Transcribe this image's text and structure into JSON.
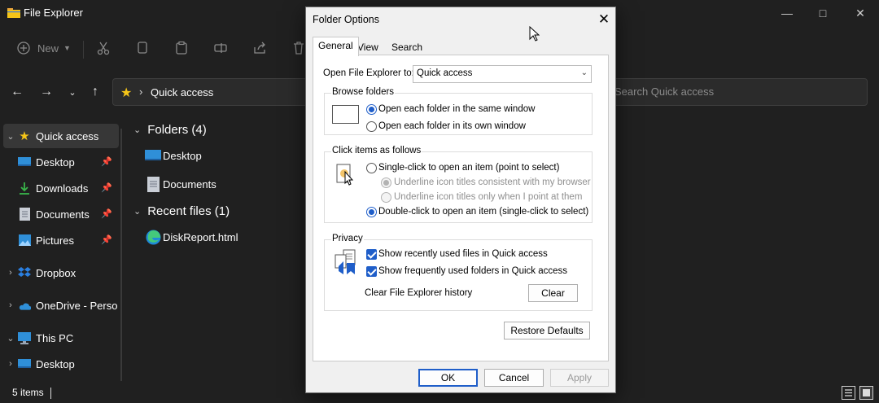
{
  "explorer": {
    "title": "File Explorer",
    "commandbar": {
      "new_label": "New"
    },
    "address": {
      "crumb": "Quick access"
    },
    "search": {
      "placeholder": "Search Quick access"
    },
    "nav_items": [
      {
        "label": "Quick access",
        "icon": "star-icon"
      },
      {
        "label": "Desktop",
        "icon": "desktop-icon"
      },
      {
        "label": "Downloads",
        "icon": "download-icon"
      },
      {
        "label": "Documents",
        "icon": "documents-icon"
      },
      {
        "label": "Pictures",
        "icon": "pictures-icon"
      },
      {
        "label": "Dropbox",
        "icon": "dropbox-icon"
      },
      {
        "label": "OneDrive - Perso",
        "icon": "onedrive-icon"
      },
      {
        "label": "This PC",
        "icon": "pc-icon"
      },
      {
        "label": "Desktop",
        "icon": "desktop-icon"
      }
    ],
    "groups": {
      "folders_header": "Folders (4)",
      "folders": [
        "Desktop",
        "Documents"
      ],
      "recent_header": "Recent files (1)",
      "recent": [
        "DiskReport.html"
      ]
    },
    "status": {
      "count": "5 items"
    }
  },
  "dialog": {
    "title": "Folder Options",
    "tabs": [
      "General",
      "View",
      "Search"
    ],
    "open_to_label": "Open File Explorer to:",
    "open_to_value": "Quick access",
    "browse": {
      "title": "Browse folders",
      "same_window": "Open each folder in the same window",
      "own_window": "Open each folder in its own window"
    },
    "click": {
      "title": "Click items as follows",
      "single": "Single-click to open an item (point to select)",
      "underline_browser": "Underline icon titles consistent with my browser",
      "underline_point": "Underline icon titles only when I point at them",
      "double": "Double-click to open an item (single-click to select)"
    },
    "privacy": {
      "title": "Privacy",
      "recent_files": "Show recently used files in Quick access",
      "frequent_folders": "Show frequently used folders in Quick access",
      "clear_history": "Clear File Explorer history",
      "clear_button": "Clear"
    },
    "restore_defaults": "Restore Defaults",
    "ok": "OK",
    "cancel": "Cancel",
    "apply": "Apply"
  },
  "colors": {
    "accent": "#1f5ec9",
    "dark_bg": "#202020",
    "folder_yellow": "#f5c518"
  }
}
